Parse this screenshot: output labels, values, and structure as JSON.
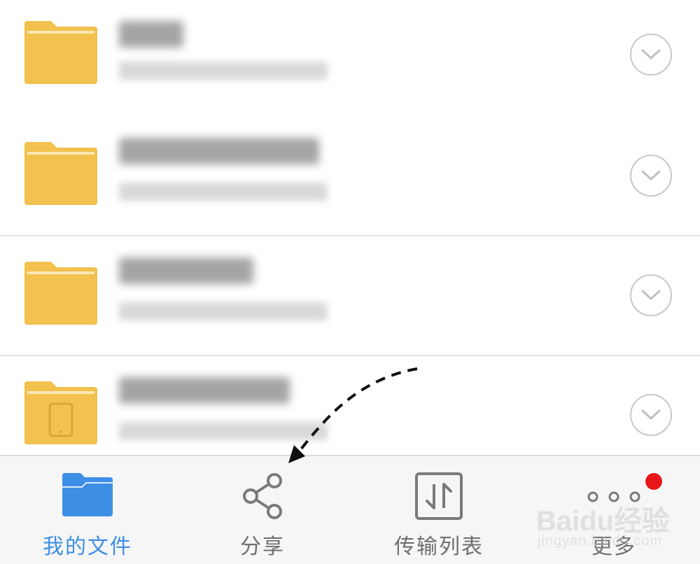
{
  "folders": [
    {
      "icon": "folder-icon"
    },
    {
      "icon": "folder-icon"
    },
    {
      "icon": "folder-icon"
    },
    {
      "icon": "folder-tablet-icon"
    }
  ],
  "tabbar": {
    "tabs": [
      {
        "id": "my-files",
        "label": "我的文件",
        "icon": "folder-icon",
        "active": true
      },
      {
        "id": "share",
        "label": "分享",
        "icon": "share-icon",
        "active": false
      },
      {
        "id": "transfer-list",
        "label": "传输列表",
        "icon": "transfer-icon",
        "active": false
      },
      {
        "id": "more",
        "label": "更多",
        "icon": "more-dots-icon",
        "active": false
      }
    ]
  },
  "colors": {
    "accent": "#3d8fe6",
    "folder": "#f2c14e",
    "badge": "#e8161b",
    "divider": "#e4e4e4"
  },
  "watermark": {
    "brand": "Baidu经验",
    "sub": "jingyan.baidu.com"
  }
}
